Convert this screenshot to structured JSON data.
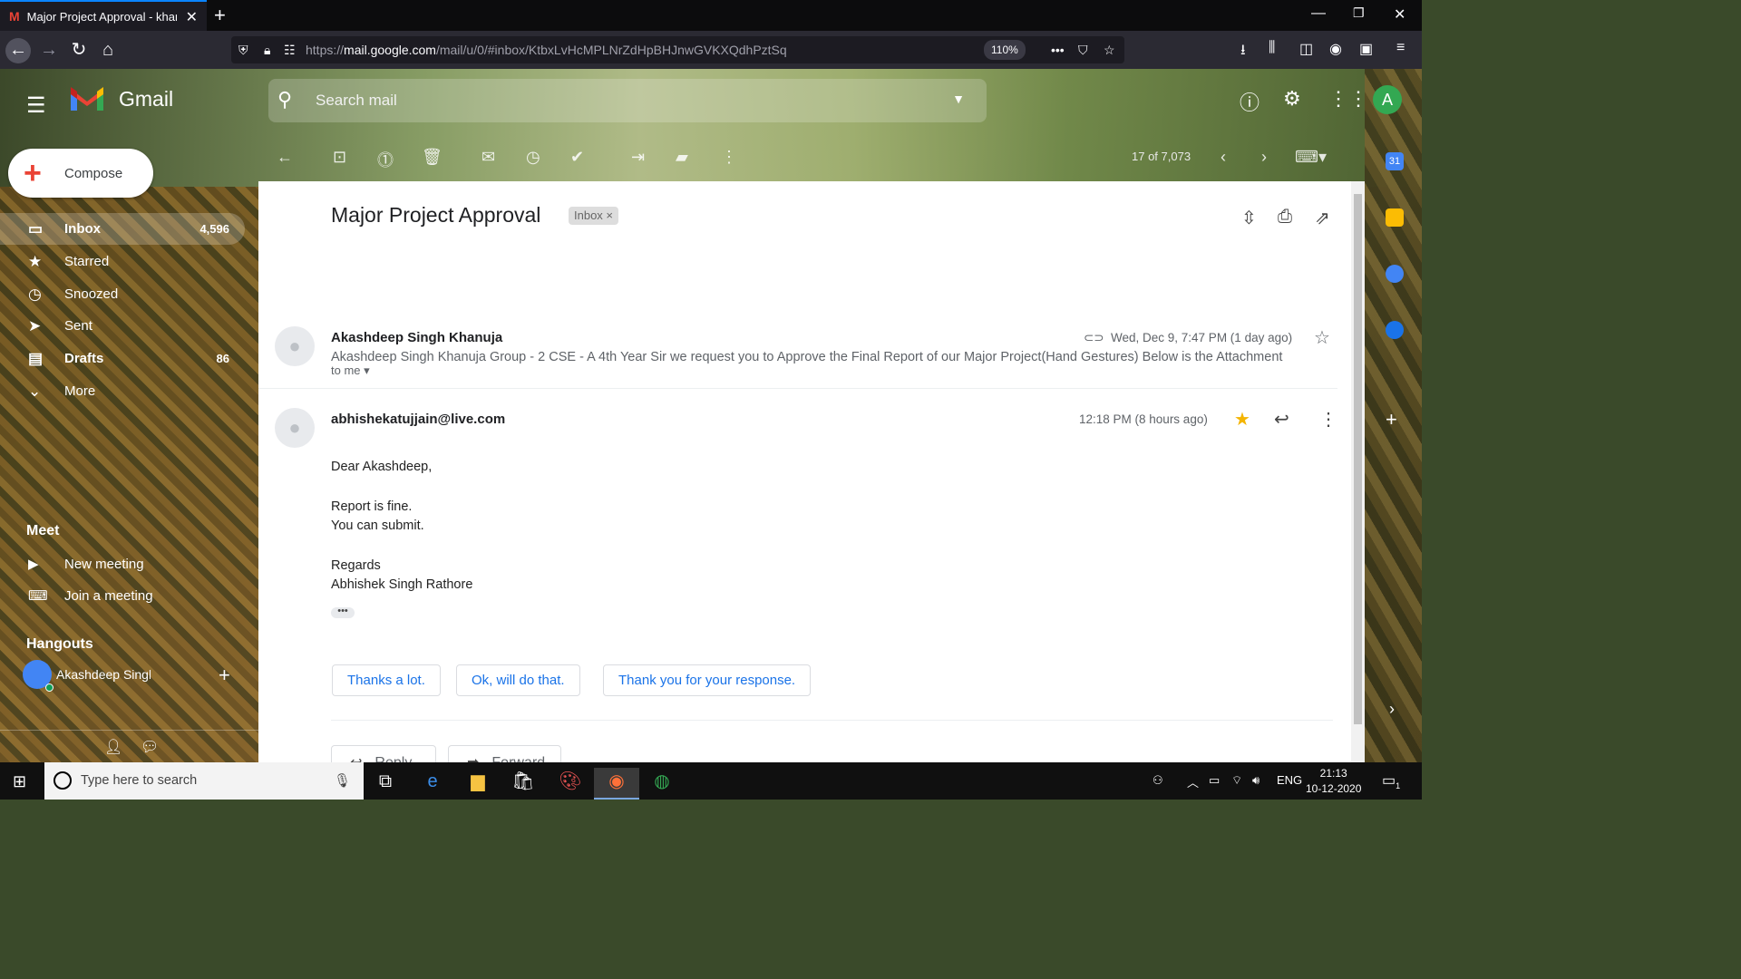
{
  "browser": {
    "tab_title": "Major Project Approval - khanuja",
    "tab_close": "✕",
    "new_tab": "+",
    "url_host": "mail.google.com",
    "url_prefix": "https://",
    "url_path": "/mail/u/0/#inbox/KtbxLvHcMPLNrZdHpBHJnwGVKXQdhPztSq",
    "zoom": "110%"
  },
  "gmail": {
    "app_name": "Gmail",
    "search_placeholder": "Search mail",
    "account_initial": "A",
    "compose_label": "Compose",
    "nav": [
      {
        "label": "Inbox",
        "count": "4,596",
        "icon": "inbox-icon"
      },
      {
        "label": "Starred",
        "count": "",
        "icon": "star-icon"
      },
      {
        "label": "Snoozed",
        "count": "",
        "icon": "clock-icon"
      },
      {
        "label": "Sent",
        "count": "",
        "icon": "send-icon"
      },
      {
        "label": "Drafts",
        "count": "86",
        "icon": "draft-icon"
      },
      {
        "label": "More",
        "count": "",
        "icon": "chevron-down-icon"
      }
    ],
    "meet": {
      "heading": "Meet",
      "new_meeting": "New meeting",
      "join_meeting": "Join a meeting"
    },
    "hangouts": {
      "heading": "Hangouts",
      "contact": "Akashdeep Singh Khanuja"
    },
    "toolbar": {
      "pager": "17 of 7,073"
    }
  },
  "thread": {
    "subject": "Major Project Approval",
    "label_tag": "Inbox",
    "messages": [
      {
        "sender": "Akashdeep Singh Khanuja",
        "date": "Wed, Dec 9, 7:47 PM (1 day ago)",
        "snippet": "Akashdeep Singh Khanuja Group - 2 CSE - A 4th Year Sir we request you to Approve the Final Report of our Major Project(Hand Gestures) Below is the Attachment"
      },
      {
        "sender": "abhishekatujjain@live.com",
        "date": "12:18 PM (8 hours ago)",
        "to": "to me",
        "body": [
          "Dear Akashdeep,",
          "Report is fine.",
          "You can submit.",
          "Regards",
          "Abhishek Singh Rathore"
        ]
      }
    ],
    "smart_replies": [
      "Thanks a lot.",
      "Ok, will do that.",
      "Thank you for your response."
    ],
    "reply_label": "Reply",
    "forward_label": "Forward"
  },
  "taskbar": {
    "search_placeholder": "Type here to search",
    "lang": "ENG",
    "time": "21:13",
    "date": "10-12-2020",
    "notif_count": "1"
  }
}
